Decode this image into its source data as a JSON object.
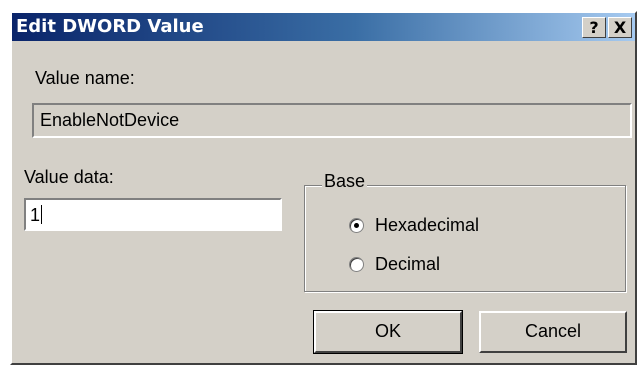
{
  "window": {
    "title": "Edit DWORD Value",
    "help_label": "?",
    "close_label": "X"
  },
  "value_name": {
    "label": "Value name:",
    "value": "EnableNotDevice"
  },
  "value_data": {
    "label": "Value data:",
    "value": "1"
  },
  "base": {
    "legend": "Base",
    "options": [
      {
        "label": "Hexadecimal",
        "selected": true
      },
      {
        "label": "Decimal",
        "selected": false
      }
    ]
  },
  "buttons": {
    "ok_label": "OK",
    "cancel_label": "Cancel"
  },
  "colors": {
    "titlebar_start": "#0a246a",
    "titlebar_end": "#a6caf0",
    "dialog_face": "#d4d0c8"
  }
}
